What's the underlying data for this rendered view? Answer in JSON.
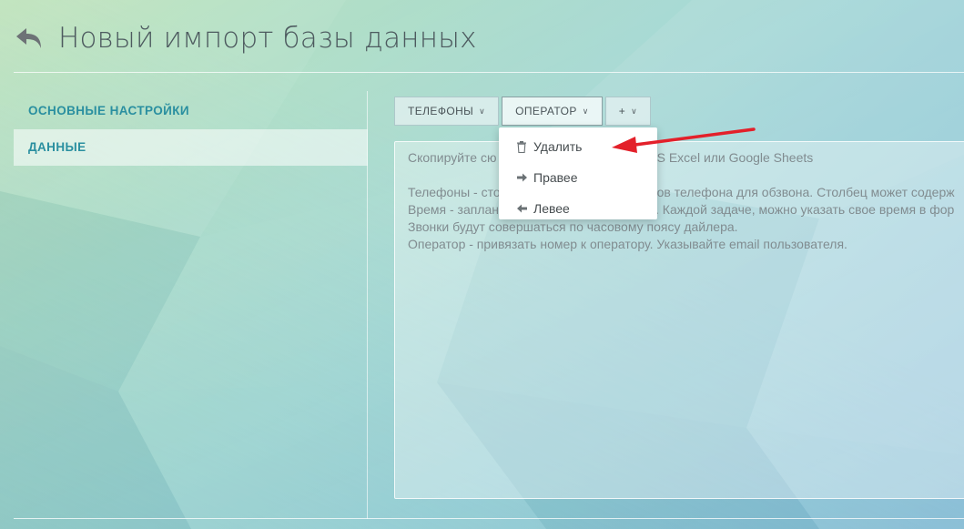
{
  "header": {
    "title": "Новый импорт базы данных"
  },
  "sidebar": {
    "items": [
      {
        "label": "ОСНОВНЫЕ НАСТРОЙКИ"
      },
      {
        "label": "ДАННЫЕ"
      }
    ]
  },
  "columns": {
    "tabs": [
      {
        "label": "ТЕЛЕФОНЫ"
      },
      {
        "label": "ОПЕРАТОР"
      },
      {
        "label": "+"
      }
    ]
  },
  "textarea": {
    "line1": "Скопируйте сю",
    "line1b": "в из MS Excel или Google Sheets",
    "line2": "Телефоны - сто",
    "line2b": "ов телефона для обзвона. Столбец может содерж",
    "line3": "Время - заплан",
    "line3b": ". Каждой задаче, можно указать свое время в фор",
    "line4": "Звонки будут совершаться по часовому поясу дайлера.",
    "line5": "Оператор - привязать номер к оператору. Указывайте email пользователя."
  },
  "dropdown": {
    "items": [
      {
        "label": "Удалить",
        "icon": "trash-icon"
      },
      {
        "label": "Правее",
        "icon": "arrow-right-icon"
      },
      {
        "label": "Левее",
        "icon": "arrow-left-icon"
      }
    ]
  },
  "colors": {
    "accent": "#2a8fa0",
    "annotation_arrow": "#e3202a"
  }
}
